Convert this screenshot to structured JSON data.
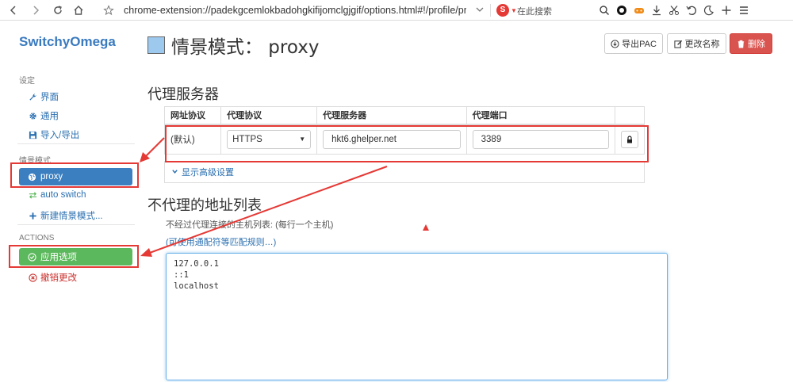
{
  "browser": {
    "url": "chrome-extension://padekgcemlokbadohgkifijomclgjgif/options.html#!/profile/proxy",
    "search_placeholder": "在此搜索",
    "search_logo": "S"
  },
  "sidebar": {
    "brand": "SwitchyOmega",
    "settings_header": "设定",
    "settings_items": [
      "界面",
      "通用",
      "导入/导出"
    ],
    "profiles_header": "情景模式",
    "profiles": [
      "proxy",
      "auto switch"
    ],
    "new_profile": "新建情景模式...",
    "actions_header": "ACTIONS",
    "apply": "应用选项",
    "discard": "撤销更改"
  },
  "main": {
    "title": "情景模式： proxy",
    "swatch_color": "#9ec9ee",
    "buttons": {
      "export_pac": "导出PAC",
      "rename": "更改名称",
      "delete": "删除"
    },
    "proxy_section_title": "代理服务器",
    "table": {
      "headers": [
        "网址协议",
        "代理协议",
        "代理服务器",
        "代理端口"
      ],
      "row": {
        "scheme": "(默认)",
        "protocol": "HTTPS",
        "server": "hkt6.ghelper.net",
        "port": "3389"
      }
    },
    "advanced": "显示高级设置",
    "bypass_section_title": "不代理的地址列表",
    "bypass_hint": "不经过代理连接的主机列表: (每行一个主机)",
    "bypass_hint2": "(可使用通配符等匹配规则…)",
    "bypass_list": [
      "127.0.0.1",
      "::1",
      "localhost"
    ]
  },
  "annotation_color": "#e53935"
}
